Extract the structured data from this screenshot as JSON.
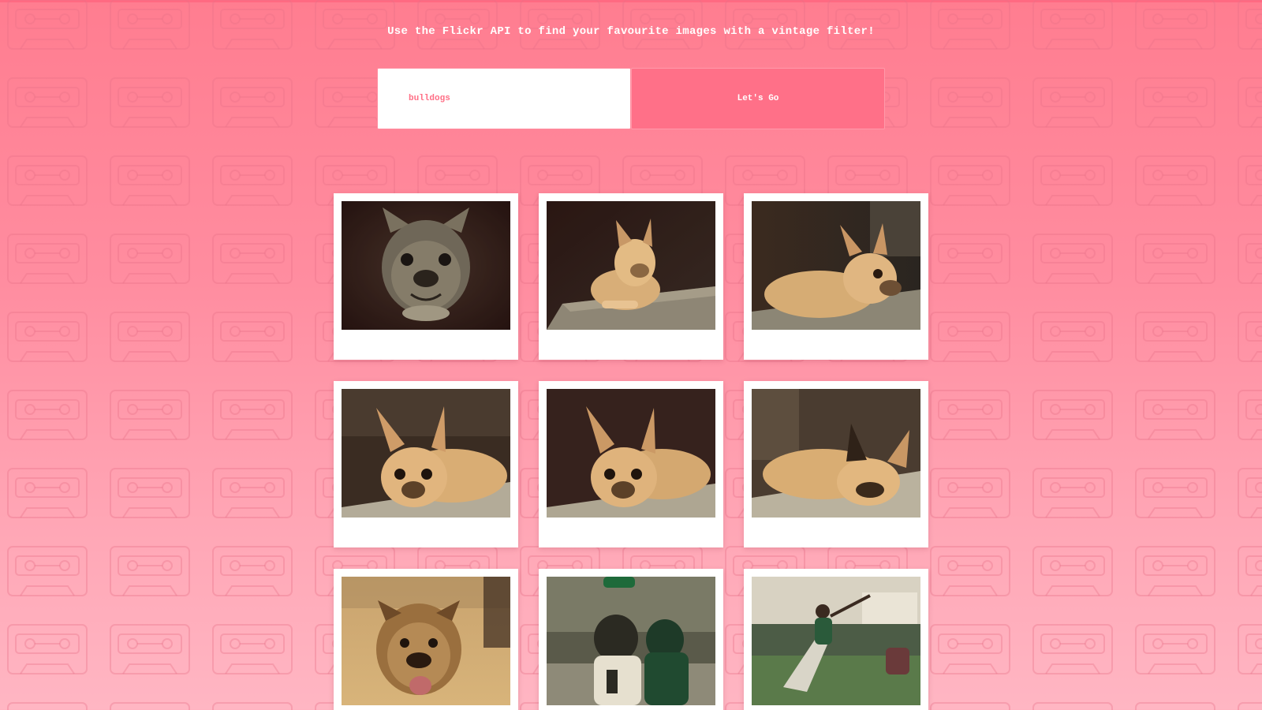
{
  "header": {
    "tagline": "Use the Flickr API to find your favourite images with a vintage filter!"
  },
  "search": {
    "value": "bulldogs",
    "button_label": "Let's Go"
  },
  "colors": {
    "background_top": "#ff7d90",
    "background_bottom": "#ffb6c3",
    "accent": "#ff7088",
    "input_text": "#ff6f86",
    "card": "#ffffff"
  },
  "gallery": {
    "photos": [
      {
        "subject": "french-bulldog-face-portrait"
      },
      {
        "subject": "french-bulldog-lying-in-sun"
      },
      {
        "subject": "french-bulldog-resting-head"
      },
      {
        "subject": "french-bulldog-lying-looking-forward"
      },
      {
        "subject": "french-bulldog-lying-looking-forward-2"
      },
      {
        "subject": "french-bulldog-sleeping"
      },
      {
        "subject": "english-bulldog-standing"
      },
      {
        "subject": "baseball-catcher-and-player"
      },
      {
        "subject": "baseball-batter-swinging"
      }
    ]
  }
}
